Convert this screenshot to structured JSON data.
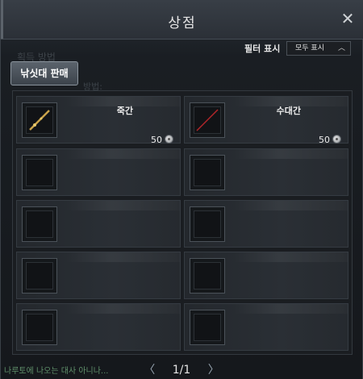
{
  "window": {
    "title": "상점"
  },
  "filter": {
    "label": "필터 표시",
    "selected": "모두 표시"
  },
  "background": {
    "ghost_title": "획득 방법",
    "ghost_subtitle": "방법:",
    "chat_text": "나루토에 나오는 대사 아니나..."
  },
  "tab": {
    "label": "낚싯대 판매"
  },
  "items": [
    {
      "name": "죽간",
      "price": "50",
      "icon": "bamboo-rod-icon",
      "rod_color": "#c9a24a"
    },
    {
      "name": "수대간",
      "price": "50",
      "icon": "red-rod-icon",
      "rod_color": "#b3262a"
    },
    {
      "name": "",
      "price": ""
    },
    {
      "name": "",
      "price": ""
    },
    {
      "name": "",
      "price": ""
    },
    {
      "name": "",
      "price": ""
    },
    {
      "name": "",
      "price": ""
    },
    {
      "name": "",
      "price": ""
    },
    {
      "name": "",
      "price": ""
    },
    {
      "name": "",
      "price": ""
    }
  ],
  "pager": {
    "current": "1/1"
  },
  "colors": {
    "accent": "#8a939c",
    "background": "#15181c"
  }
}
